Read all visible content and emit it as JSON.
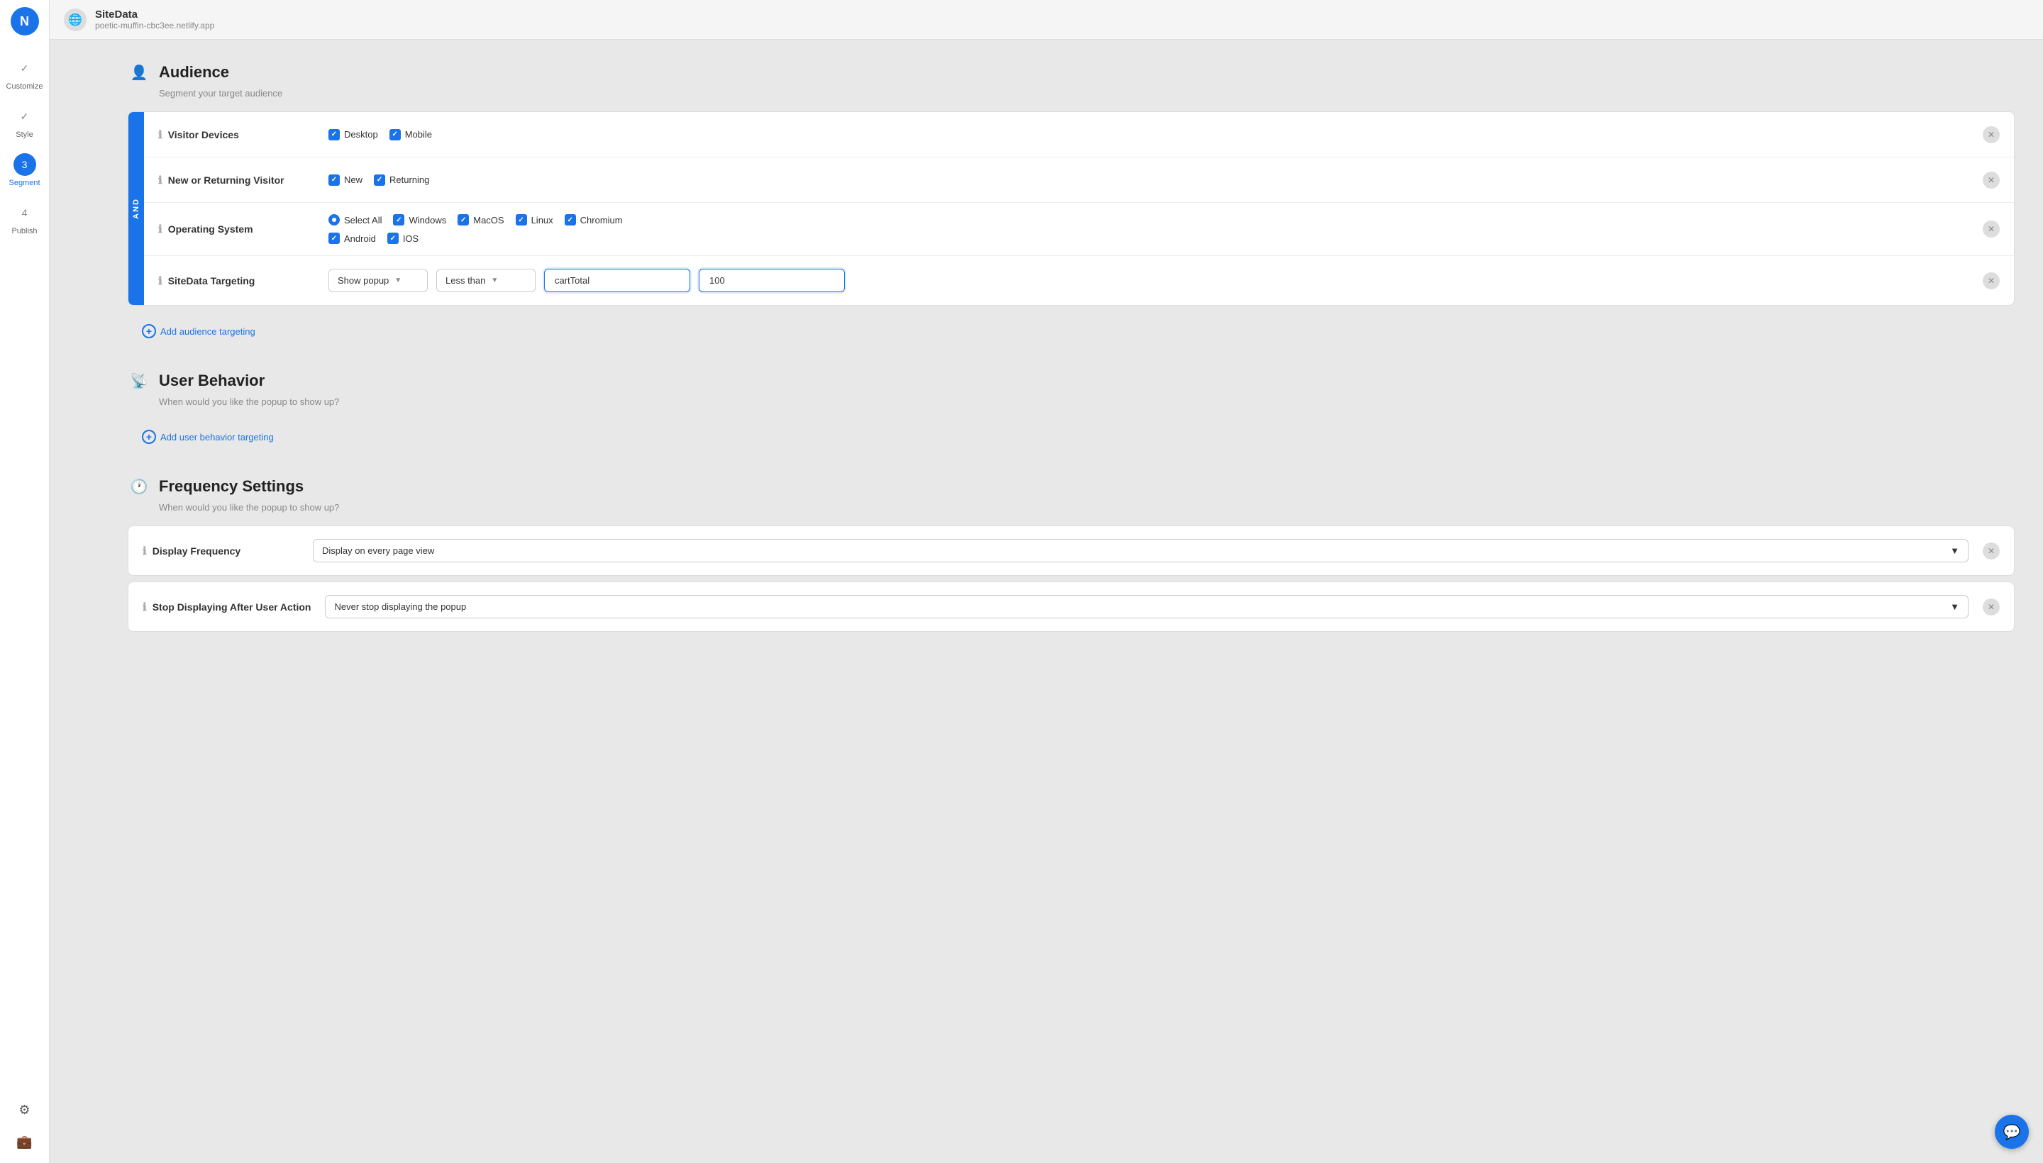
{
  "app": {
    "logo": "N",
    "site_name": "SiteData",
    "site_url": "poetic-muffin-cbc3ee.netlify.app"
  },
  "sidebar": {
    "items": [
      {
        "label": "Customize",
        "step": "✓",
        "active": false
      },
      {
        "label": "Style",
        "step": "✓",
        "active": false
      },
      {
        "label": "Segment",
        "step": "3",
        "active": true
      },
      {
        "label": "Publish",
        "step": "4",
        "active": false
      }
    ]
  },
  "audience": {
    "title": "Audience",
    "subtitle": "Segment your target audience",
    "and_label": "AND",
    "rows": [
      {
        "id": "visitor-devices",
        "label": "Visitor Devices",
        "options": [
          {
            "type": "checkbox",
            "label": "Desktop",
            "checked": true
          },
          {
            "type": "checkbox",
            "label": "Mobile",
            "checked": true
          }
        ]
      },
      {
        "id": "new-returning",
        "label": "New or Returning Visitor",
        "options": [
          {
            "type": "checkbox",
            "label": "New",
            "checked": true
          },
          {
            "type": "checkbox",
            "label": "Returning",
            "checked": true
          }
        ]
      },
      {
        "id": "operating-system",
        "label": "Operating System",
        "options_row1": [
          {
            "type": "radio",
            "label": "Select All",
            "checked": true
          },
          {
            "type": "checkbox",
            "label": "Windows",
            "checked": true
          },
          {
            "type": "checkbox",
            "label": "MacOS",
            "checked": true
          },
          {
            "type": "checkbox",
            "label": "Linux",
            "checked": true
          },
          {
            "type": "checkbox",
            "label": "Chromium",
            "checked": true
          }
        ],
        "options_row2": [
          {
            "type": "checkbox",
            "label": "Android",
            "checked": true
          },
          {
            "type": "checkbox",
            "label": "IOS",
            "checked": true
          }
        ]
      },
      {
        "id": "sitedata-targeting",
        "label": "SiteData Targeting",
        "show_popup_label": "Show popup",
        "condition_label": "Less than",
        "variable_value": "cartTotal",
        "number_value": "100"
      }
    ],
    "add_targeting_label": "Add audience targeting"
  },
  "user_behavior": {
    "title": "User Behavior",
    "subtitle": "When would you like the popup to show up?",
    "add_label": "Add user behavior targeting"
  },
  "frequency": {
    "title": "Frequency Settings",
    "subtitle": "When would you like the popup to show up?",
    "rows": [
      {
        "label": "Display Frequency",
        "value": "Display on every page view"
      },
      {
        "label": "Stop Displaying After User Action",
        "value": "Never stop displaying the popup"
      }
    ]
  },
  "chat_button_icon": "💬"
}
